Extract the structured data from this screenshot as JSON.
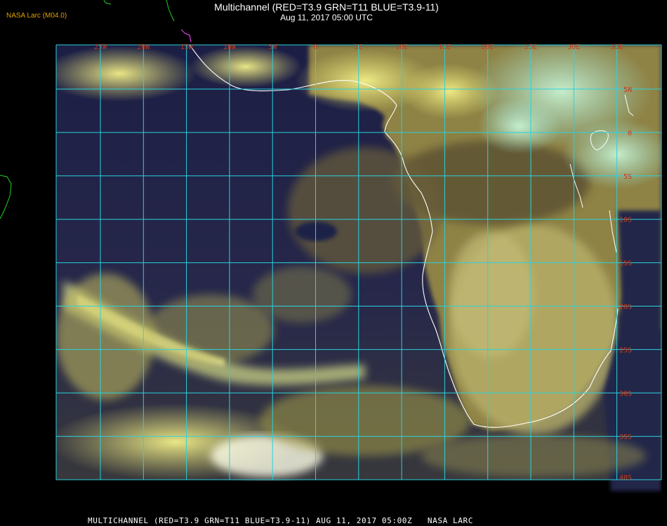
{
  "header": {
    "credit": "NASA Larc (M04.0)",
    "title": "Multichannel (RED=T3.9 GRN=T11 BLUE=T3.9-11)",
    "timestamp": "Aug 11, 2017 05:00 UTC"
  },
  "footer": {
    "text": "MULTICHANNEL (RED=T3.9 GRN=T11 BLUE=T3.9-11) AUG 11, 2017 05:00Z   NASA LARC"
  },
  "map": {
    "grid_color": "#29d3dc",
    "label_color": "#cc3a1a",
    "coast_color": "#ffffff",
    "lon_labels": [
      "25W",
      "20W",
      "15W",
      "10W",
      "5W",
      "0",
      "5E",
      "10E",
      "15E",
      "20E",
      "25E",
      "30E",
      "35E"
    ],
    "lat_labels": [
      "5N",
      "0",
      "5S",
      "10S",
      "15S",
      "20S",
      "25S",
      "30S",
      "35S",
      "40S"
    ]
  }
}
